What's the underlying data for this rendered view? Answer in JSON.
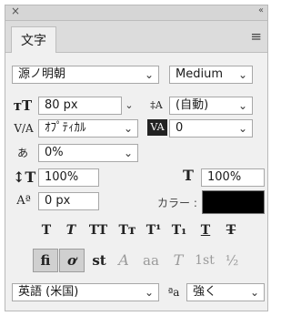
{
  "panel": {
    "tab_label": "文字",
    "close_glyph": "×",
    "collapse_glyph": "‹‹",
    "menu_glyph": "≡"
  },
  "font": {
    "family": "源ノ明朝",
    "style": "Medium"
  },
  "size": {
    "font_size": "80 px",
    "leading": "(自動)"
  },
  "kerning": {
    "value": "ｵﾌﾟﾃｨｶﾙ",
    "tracking": "0"
  },
  "tsume": {
    "value": "0%"
  },
  "scale": {
    "vertical": "100%",
    "horizontal": "100%"
  },
  "baseline": {
    "shift": "0 px"
  },
  "color": {
    "label": "カラー :",
    "value": "#000000"
  },
  "style_buttons": {
    "faux_bold": "T",
    "faux_italic": "T",
    "all_caps": "TT",
    "small_caps": "Tт",
    "superscript": "T¹",
    "subscript": "T₁",
    "underline": "T",
    "strikethrough": "T"
  },
  "opentype_buttons": {
    "ligatures": "fi",
    "contextual_alternates": "ơ",
    "discretionary_ligatures": "st",
    "swash": "A",
    "stylistic_alternates": "aa",
    "titling": "T",
    "ordinals": "1st",
    "fractions": "½"
  },
  "language": {
    "value": "英語 (米国)"
  },
  "antialias": {
    "icon_text": "ªa",
    "value": "強く"
  }
}
